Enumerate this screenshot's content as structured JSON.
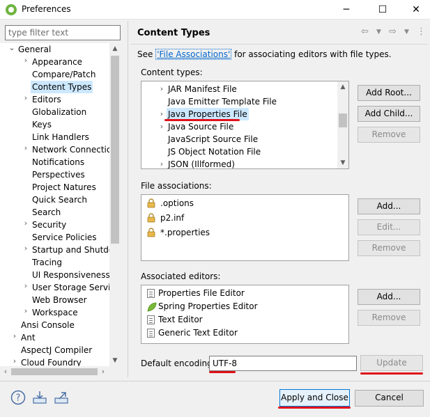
{
  "window": {
    "title": "Preferences",
    "minimize": "─",
    "maximize": "☐",
    "close": "✕"
  },
  "filter": {
    "placeholder": "type filter text"
  },
  "tree": {
    "items": [
      {
        "label": "General",
        "twisty": "⌄"
      },
      {
        "label": "Appearance",
        "twisty": "›"
      },
      {
        "label": "Compare/Patch",
        "twisty": ""
      },
      {
        "label": "Content Types",
        "twisty": ""
      },
      {
        "label": "Editors",
        "twisty": "›"
      },
      {
        "label": "Globalization",
        "twisty": ""
      },
      {
        "label": "Keys",
        "twisty": ""
      },
      {
        "label": "Link Handlers",
        "twisty": ""
      },
      {
        "label": "Network Connections",
        "twisty": "›"
      },
      {
        "label": "Notifications",
        "twisty": ""
      },
      {
        "label": "Perspectives",
        "twisty": ""
      },
      {
        "label": "Project Natures",
        "twisty": ""
      },
      {
        "label": "Quick Search",
        "twisty": ""
      },
      {
        "label": "Search",
        "twisty": ""
      },
      {
        "label": "Security",
        "twisty": "›"
      },
      {
        "label": "Service Policies",
        "twisty": ""
      },
      {
        "label": "Startup and Shutdown",
        "twisty": "›"
      },
      {
        "label": "Tracing",
        "twisty": ""
      },
      {
        "label": "UI Responsiveness Monitoring",
        "twisty": ""
      },
      {
        "label": "User Storage Service",
        "twisty": "›"
      },
      {
        "label": "Web Browser",
        "twisty": ""
      },
      {
        "label": "Workspace",
        "twisty": "›"
      },
      {
        "label": "Ansi Console",
        "twisty": ""
      },
      {
        "label": "Ant",
        "twisty": "›"
      },
      {
        "label": "AspectJ Compiler",
        "twisty": ""
      },
      {
        "label": "Cloud Foundry",
        "twisty": "›"
      }
    ]
  },
  "page": {
    "title": "Content Types",
    "see_prefix": "See ",
    "see_link": "'File Associations'",
    "see_suffix": " for associating editors with file types.",
    "content_types_label": "Content types:",
    "content_types": [
      {
        "label": "JAR Manifest File",
        "twisty": "›"
      },
      {
        "label": "Java Emitter Template File",
        "twisty": ""
      },
      {
        "label": "Java Properties File",
        "twisty": "›"
      },
      {
        "label": "Java Source File",
        "twisty": "›"
      },
      {
        "label": "JavaScript Source File",
        "twisty": ""
      },
      {
        "label": "JS Object Notation File",
        "twisty": ""
      },
      {
        "label": "JSON (Illformed)",
        "twisty": "›"
      }
    ],
    "add_root": "Add Root...",
    "add_child": "Add Child...",
    "remove": "Remove",
    "file_assoc_label": "File associations:",
    "file_assocs": [
      ".options",
      "p2.inf",
      "*.properties"
    ],
    "add": "Add...",
    "edit": "Edit...",
    "assoc_editors_label": "Associated editors:",
    "editors": [
      "Properties File Editor",
      "Spring Properties Editor",
      "Text Editor",
      "Generic Text Editor"
    ],
    "default_encoding_label": "Default encoding:",
    "default_encoding_value": "UTF-8",
    "update": "Update"
  },
  "footer": {
    "apply_close": "Apply and Close",
    "cancel": "Cancel"
  },
  "colors": {
    "selection": "#cce8ff",
    "link": "#0066cc",
    "annotation_red": "#e0111a"
  }
}
